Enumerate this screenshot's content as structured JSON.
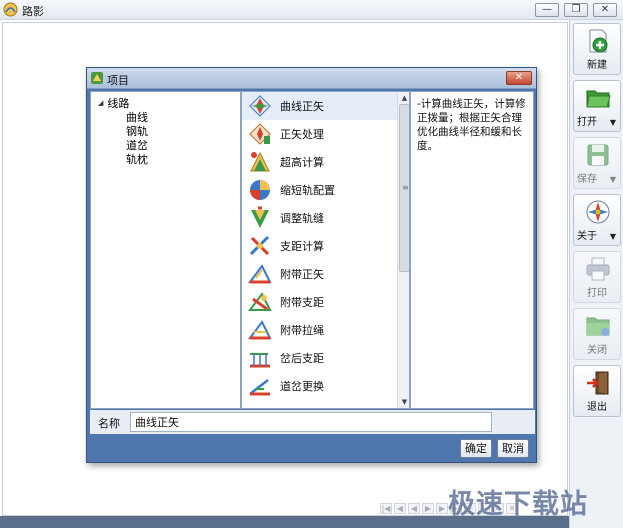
{
  "window": {
    "title": "路影",
    "minimize": "—",
    "restore": "❐",
    "close": "✕"
  },
  "toolbar": {
    "new_label": "新建",
    "open_label": "打开",
    "save_label": "保存",
    "about_label": "关于",
    "print_label": "打印",
    "close_label": "关闭",
    "exit_label": "退出",
    "dropdown_glyph": "▼"
  },
  "dialog": {
    "title": "项目",
    "close_glyph": "✕",
    "tree": {
      "root": "线路",
      "children": [
        "曲线",
        "钢轨",
        "道岔",
        "轨枕"
      ]
    },
    "items": [
      {
        "label": "曲线正矢",
        "icon": "curve-icon"
      },
      {
        "label": "正矢处理",
        "icon": "process-icon"
      },
      {
        "label": "超高计算",
        "icon": "superelevation-icon"
      },
      {
        "label": "缩短轨配置",
        "icon": "rail-config-icon"
      },
      {
        "label": "调整轨缝",
        "icon": "gap-icon"
      },
      {
        "label": "支距计算",
        "icon": "offset-icon"
      },
      {
        "label": "附带正矢",
        "icon": "attached-versine-icon"
      },
      {
        "label": "附带支距",
        "icon": "attached-offset-icon"
      },
      {
        "label": "附带拉绳",
        "icon": "rope-icon"
      },
      {
        "label": "岔后支距",
        "icon": "switch-offset-icon"
      },
      {
        "label": "道岔更换",
        "icon": "switch-replace-icon"
      }
    ],
    "description": "-计算曲线正矢，计算修正拨量；根据正矢合理优化曲线半径和缓和长度。",
    "name_label": "名称",
    "name_value": "曲线正矢",
    "ok_label": "确定",
    "cancel_label": "取消"
  },
  "pager": {
    "buttons": [
      "|◀",
      "◀",
      "◀",
      "▶",
      "▶",
      "▶|",
      "+",
      "-",
      "✓",
      "✕"
    ]
  },
  "watermark": "极速下载站",
  "colors": {
    "dialog_frame": "#4f77ad",
    "bottom_strip": "#5a6f8c",
    "watermark": "#5a6e96"
  }
}
